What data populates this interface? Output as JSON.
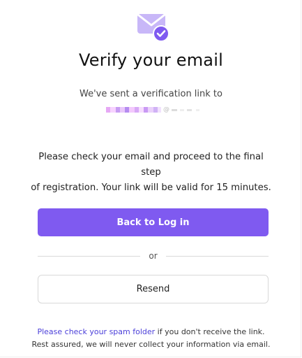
{
  "header": {
    "title": "Verify your email"
  },
  "message": {
    "sent_text": "We've sent a verification link to",
    "email_redacted": true,
    "instructions_line1": "Please check your email and proceed to the final step",
    "instructions_line2": "of registration. Your link will be valid for 15 minutes."
  },
  "actions": {
    "back_to_login_label": "Back to Log in",
    "divider_label": "or",
    "resend_label": "Resend"
  },
  "footer": {
    "spam_link_text": "Please check your spam folder",
    "line1_rest": " if you don't receive the link.",
    "line2": "Rest assured, we will never collect your information via email."
  },
  "icons": {
    "header_icon": "mail-check-icon"
  },
  "colors": {
    "accent": "#7f5af0",
    "envelope": "#c8b7f8",
    "link": "#4b3fd9",
    "button_text": "#ffffff"
  }
}
